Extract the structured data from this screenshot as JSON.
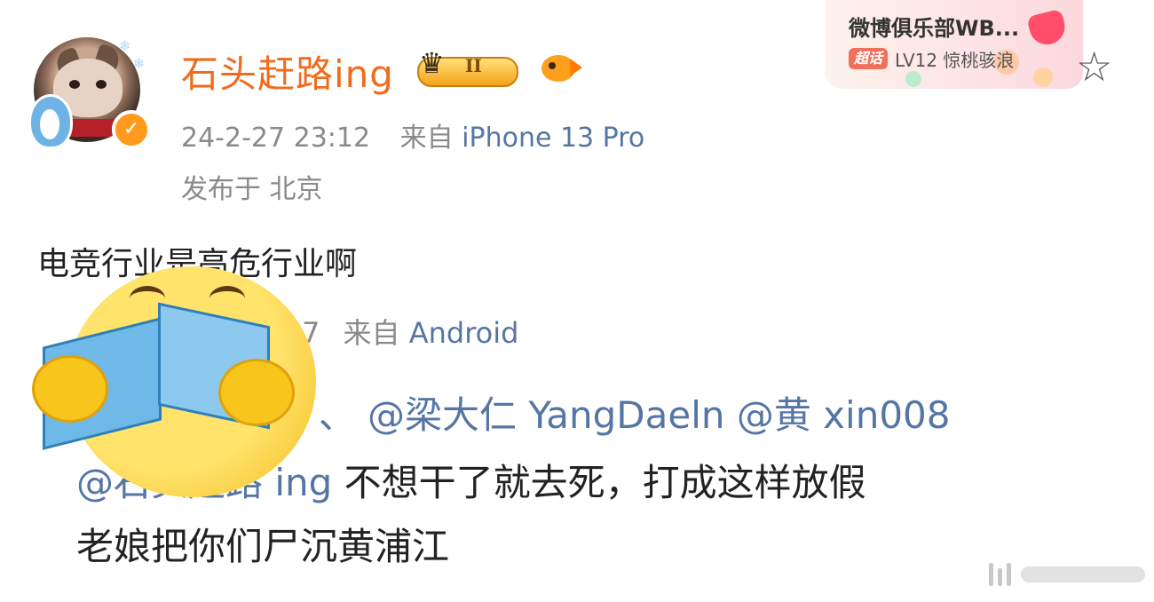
{
  "post": {
    "username": "石头赶路ing",
    "crown_level": "II",
    "timestamp": "24-2-27 23:12",
    "source_prefix": "来自",
    "source_device": "iPhone 13 Pro",
    "location": "发布于 北京",
    "text": "电竞行业是高危行业啊"
  },
  "club_card": {
    "title": "微博俱乐部WB...",
    "tag": "超话",
    "subtitle": "LV12 惊桃骇浪"
  },
  "quoted_comment": {
    "time_fragment": "7",
    "source_prefix": "来自",
    "source_device": "Android",
    "line1": "ii 、 @梁大仁 YangDaeln @黄 xin008",
    "line2_mention": "@石头赶路 ing",
    "line2_text": " 不想干了就去死，打成这样放假",
    "line3": "老娘把你们尸沉黄浦江"
  },
  "colors": {
    "username": "#f26b1d",
    "link": "#5576a4",
    "meta": "#8a8a8a",
    "text": "#222222",
    "verified_badge": "#ff9a1f"
  },
  "icons": [
    "verified-icon",
    "crown-badge-icon",
    "fish-icon",
    "star-icon",
    "emoji-reading-book-sticker",
    "watermark-icon"
  ]
}
